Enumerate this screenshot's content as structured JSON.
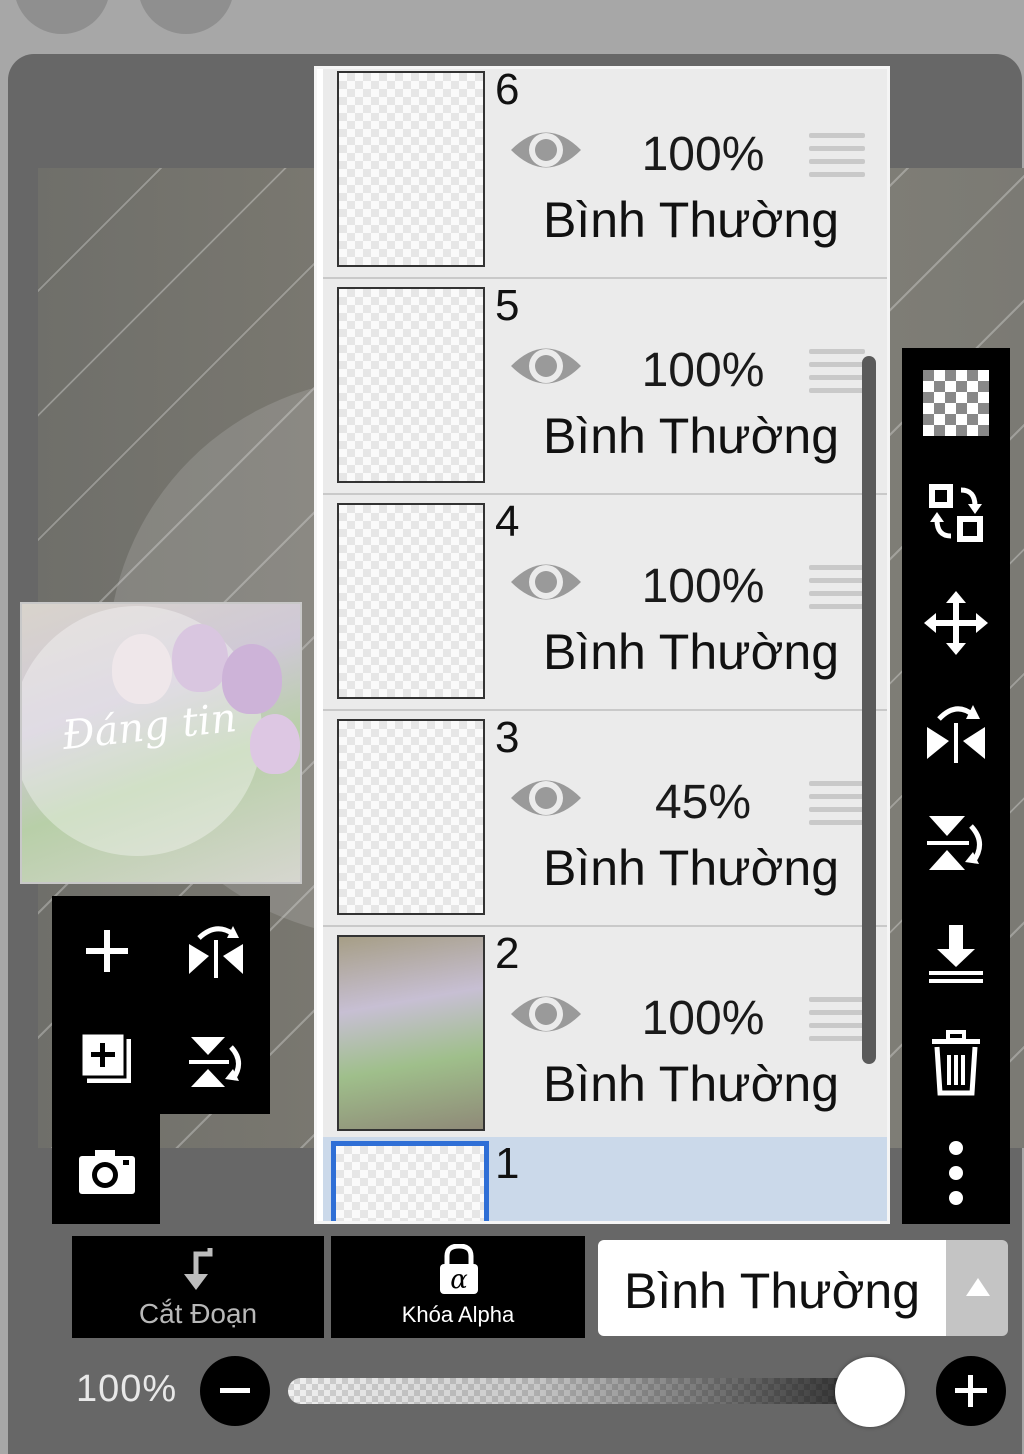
{
  "layers": [
    {
      "number": "6",
      "opacity": "100%",
      "blend": "Bình Thường",
      "thumb": "transparent",
      "selected": false
    },
    {
      "number": "5",
      "opacity": "100%",
      "blend": "Bình Thường",
      "thumb": "transparent",
      "selected": false
    },
    {
      "number": "4",
      "opacity": "100%",
      "blend": "Bình Thường",
      "thumb": "transparent",
      "selected": false
    },
    {
      "number": "3",
      "opacity": "45%",
      "blend": "Bình Thường",
      "thumb": "transparent",
      "selected": false
    },
    {
      "number": "2",
      "opacity": "100%",
      "blend": "Bình Thường",
      "thumb": "photo",
      "selected": false
    },
    {
      "number": "1",
      "opacity": "",
      "blend": "",
      "thumb": "transparent",
      "selected": true
    }
  ],
  "bottom_bar": {
    "clipping_label": "Cắt Đoạn",
    "alpha_lock_label": "Khóa Alpha",
    "blend_mode": "Bình Thường"
  },
  "opacity_control": {
    "label": "100%",
    "value": 1.0
  },
  "preview_text": "Đáng tin",
  "colors": {
    "selected_row": "#cbd9ea",
    "selected_border": "#2f6fd6",
    "toolbar": "#000000"
  }
}
